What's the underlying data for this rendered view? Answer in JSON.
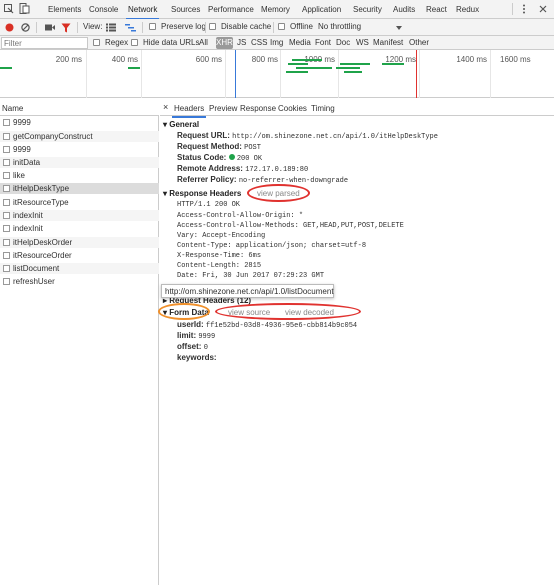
{
  "tabs": [
    {
      "label": "Elements"
    },
    {
      "label": "Console"
    },
    {
      "label": "Network"
    },
    {
      "label": "Sources"
    },
    {
      "label": "Performance"
    },
    {
      "label": "Memory"
    },
    {
      "label": "Application"
    },
    {
      "label": "Security"
    },
    {
      "label": "Audits"
    },
    {
      "label": "React"
    },
    {
      "label": "Redux"
    }
  ],
  "toolbar": {
    "view_label": "View:",
    "preserve_log": "Preserve log",
    "disable_cache": "Disable cache",
    "offline": "Offline",
    "throttling": "No throttling"
  },
  "filterbar": {
    "placeholder": "Filter",
    "regex": "Regex",
    "hide_data_urls": "Hide data URLs",
    "types": [
      "All",
      "XHR",
      "JS",
      "CSS",
      "Img",
      "Media",
      "Font",
      "Doc",
      "WS",
      "Manifest",
      "Other"
    ]
  },
  "overview": {
    "ticks": [
      "200 ms",
      "400 ms",
      "600 ms",
      "800 ms",
      "1000 ms",
      "1200 ms",
      "1400 ms",
      "1600 ms"
    ]
  },
  "list": {
    "header": "Name",
    "requests": [
      "9999",
      "getCompanyConstruct",
      "9999",
      "initData",
      "like",
      "itHelpDeskType",
      "itResourceType",
      "indexInit",
      "indexInit",
      "itHelpDeskOrder",
      "itResourceOrder",
      "listDocument",
      "refreshUser"
    ]
  },
  "detail": {
    "close": "×",
    "tabs": [
      "Headers",
      "Preview",
      "Response",
      "Cookies",
      "Timing"
    ],
    "general": {
      "title": "General",
      "request_url_label": "Request URL:",
      "request_url": "http://om.shinezone.net.cn/api/1.0/itHelpDeskType",
      "request_method_label": "Request Method:",
      "request_method": "POST",
      "status_code_label": "Status Code:",
      "status_code": "200 OK",
      "remote_address_label": "Remote Address:",
      "remote_address": "172.17.0.189:80",
      "referrer_policy_label": "Referrer Policy:",
      "referrer_policy": "no-referrer-when-downgrade"
    },
    "response_headers": {
      "title": "Response Headers",
      "view_parsed": "view parsed",
      "lines": [
        "HTTP/1.1 200 OK",
        "Access-Control-Allow-Origin: *",
        "Access-Control-Allow-Methods: GET,HEAD,PUT,POST,DELETE",
        "Vary: Accept-Encoding",
        "Content-Type: application/json; charset=utf-8",
        "X-Response-Time: 6ms",
        "Content-Length: 2815",
        "Date: Fri, 30 Jun 2017 07:29:23 GMT"
      ]
    },
    "tooltip": "http://om.shinezone.net.cn/api/1.0/listDocument",
    "request_headers": {
      "title": "Request Headers (12)"
    },
    "form_data": {
      "title": "Form Data",
      "view_source": "view source",
      "view_decoded": "view decoded",
      "fields": [
        {
          "key": "userId:",
          "value": "ff1e52bd-03d8-4936-95e6-cbb814b9c054"
        },
        {
          "key": "limit:",
          "value": "9999"
        },
        {
          "key": "offset:",
          "value": "0"
        },
        {
          "key": "keywords:",
          "value": ""
        }
      ]
    }
  },
  "colors": {
    "accent": "#3879d9",
    "record_red": "#d93025",
    "highlight_red": "#e0322f",
    "highlight_orange": "#f0902b",
    "status_green": "#1fa34a"
  }
}
